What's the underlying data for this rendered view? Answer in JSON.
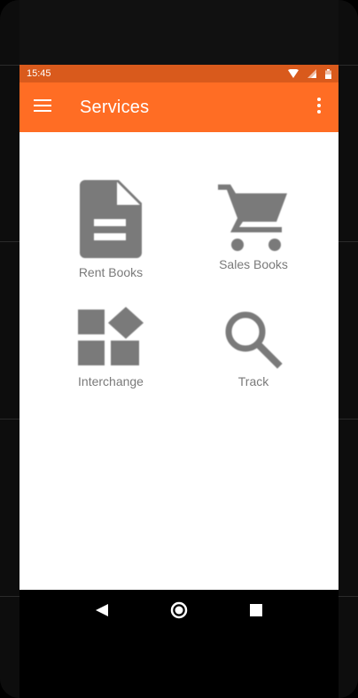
{
  "status_bar": {
    "time": "15:45",
    "icons": [
      "wifi-icon",
      "signal-icon",
      "battery-icon"
    ]
  },
  "app_bar": {
    "title": "Services",
    "menu_icon": "hamburger-menu-icon",
    "overflow_icon": "more-vertical-icon",
    "color": "#ff6d24",
    "status_color": "#d95a1c"
  },
  "services": [
    {
      "label": "Rent Books",
      "icon": "document-icon"
    },
    {
      "label": "Sales Books",
      "icon": "shopping-cart-icon"
    },
    {
      "label": "Interchange",
      "icon": "widgets-icon"
    },
    {
      "label": "Track",
      "icon": "search-icon"
    }
  ],
  "nav_bar": {
    "back_icon": "back-triangle-icon",
    "home_icon": "home-circle-icon",
    "recents_icon": "recents-square-icon"
  },
  "icon_color": "#7a7a7a"
}
